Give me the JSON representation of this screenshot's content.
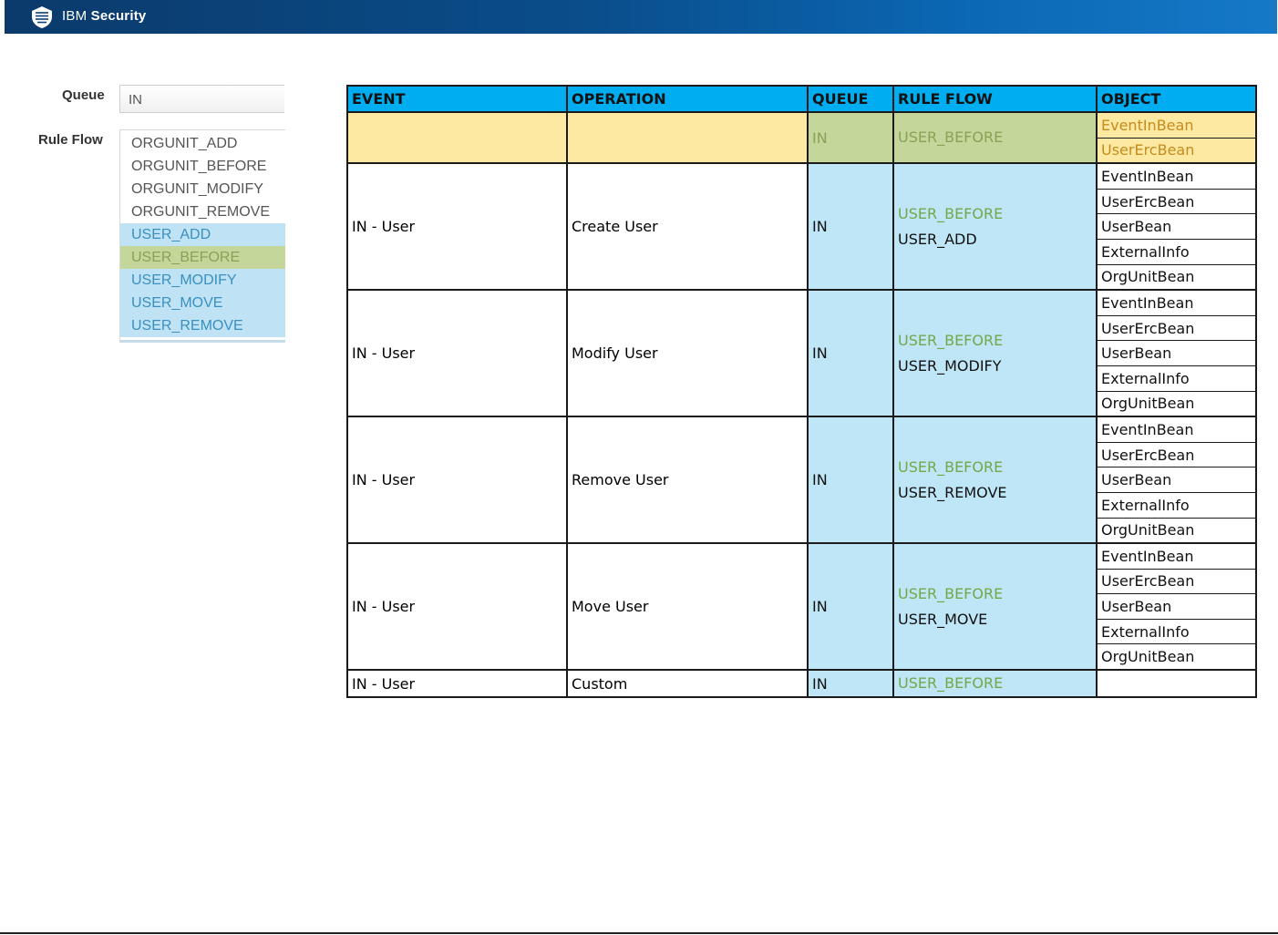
{
  "header": {
    "brand_ibm": "IBM",
    "brand_security": "Security",
    "logo_icon": "ibm-security-shield-icon"
  },
  "form": {
    "queue_label": "Queue",
    "queue_value": "IN",
    "rule_flow_label": "Rule Flow",
    "rule_flow_options": [
      "ORGUNIT_ADD",
      "ORGUNIT_BEFORE",
      "ORGUNIT_MODIFY",
      "ORGUNIT_REMOVE",
      "USER_ADD",
      "USER_BEFORE",
      "USER_MODIFY",
      "USER_MOVE",
      "USER_REMOVE"
    ]
  },
  "table": {
    "headers": [
      "EVENT",
      "OPERATION",
      "QUEUE",
      "RULE FLOW",
      "OBJECT"
    ],
    "top_row": {
      "queue": "IN",
      "rule_flow": "USER_BEFORE",
      "objects": [
        "EventInBean",
        "UserErcBean"
      ]
    },
    "rows": [
      {
        "event": "IN - User",
        "operation": "Create User",
        "queue": "IN",
        "rf_before": "USER_BEFORE",
        "rf_main": "USER_ADD",
        "objects": [
          "EventInBean",
          "UserErcBean",
          "UserBean",
          "ExternalInfo",
          "OrgUnitBean"
        ]
      },
      {
        "event": "IN - User",
        "operation": "Modify User",
        "queue": "IN",
        "rf_before": "USER_BEFORE",
        "rf_main": "USER_MODIFY",
        "objects": [
          "EventInBean",
          "UserErcBean",
          "UserBean",
          "ExternalInfo",
          "OrgUnitBean"
        ]
      },
      {
        "event": "IN - User",
        "operation": "Remove User",
        "queue": "IN",
        "rf_before": "USER_BEFORE",
        "rf_main": "USER_REMOVE",
        "objects": [
          "EventInBean",
          "UserErcBean",
          "UserBean",
          "ExternalInfo",
          "OrgUnitBean"
        ]
      },
      {
        "event": "IN - User",
        "operation": "Move User",
        "queue": "IN",
        "rf_before": "USER_BEFORE",
        "rf_main": "USER_MOVE",
        "objects": [
          "EventInBean",
          "UserErcBean",
          "UserBean",
          "ExternalInfo",
          "OrgUnitBean"
        ]
      }
    ],
    "custom_row": {
      "event": "IN - User",
      "operation": "Custom",
      "queue": "IN",
      "rule_flow": "USER_BEFORE"
    }
  },
  "colors": {
    "header_blue": "#0b4d8a",
    "table_header": "#00adf0",
    "light_blue": "#bfe6f6",
    "yellow": "#fde9a2",
    "olive_green": "#c4d699",
    "rule_green_text": "#72a84a"
  }
}
